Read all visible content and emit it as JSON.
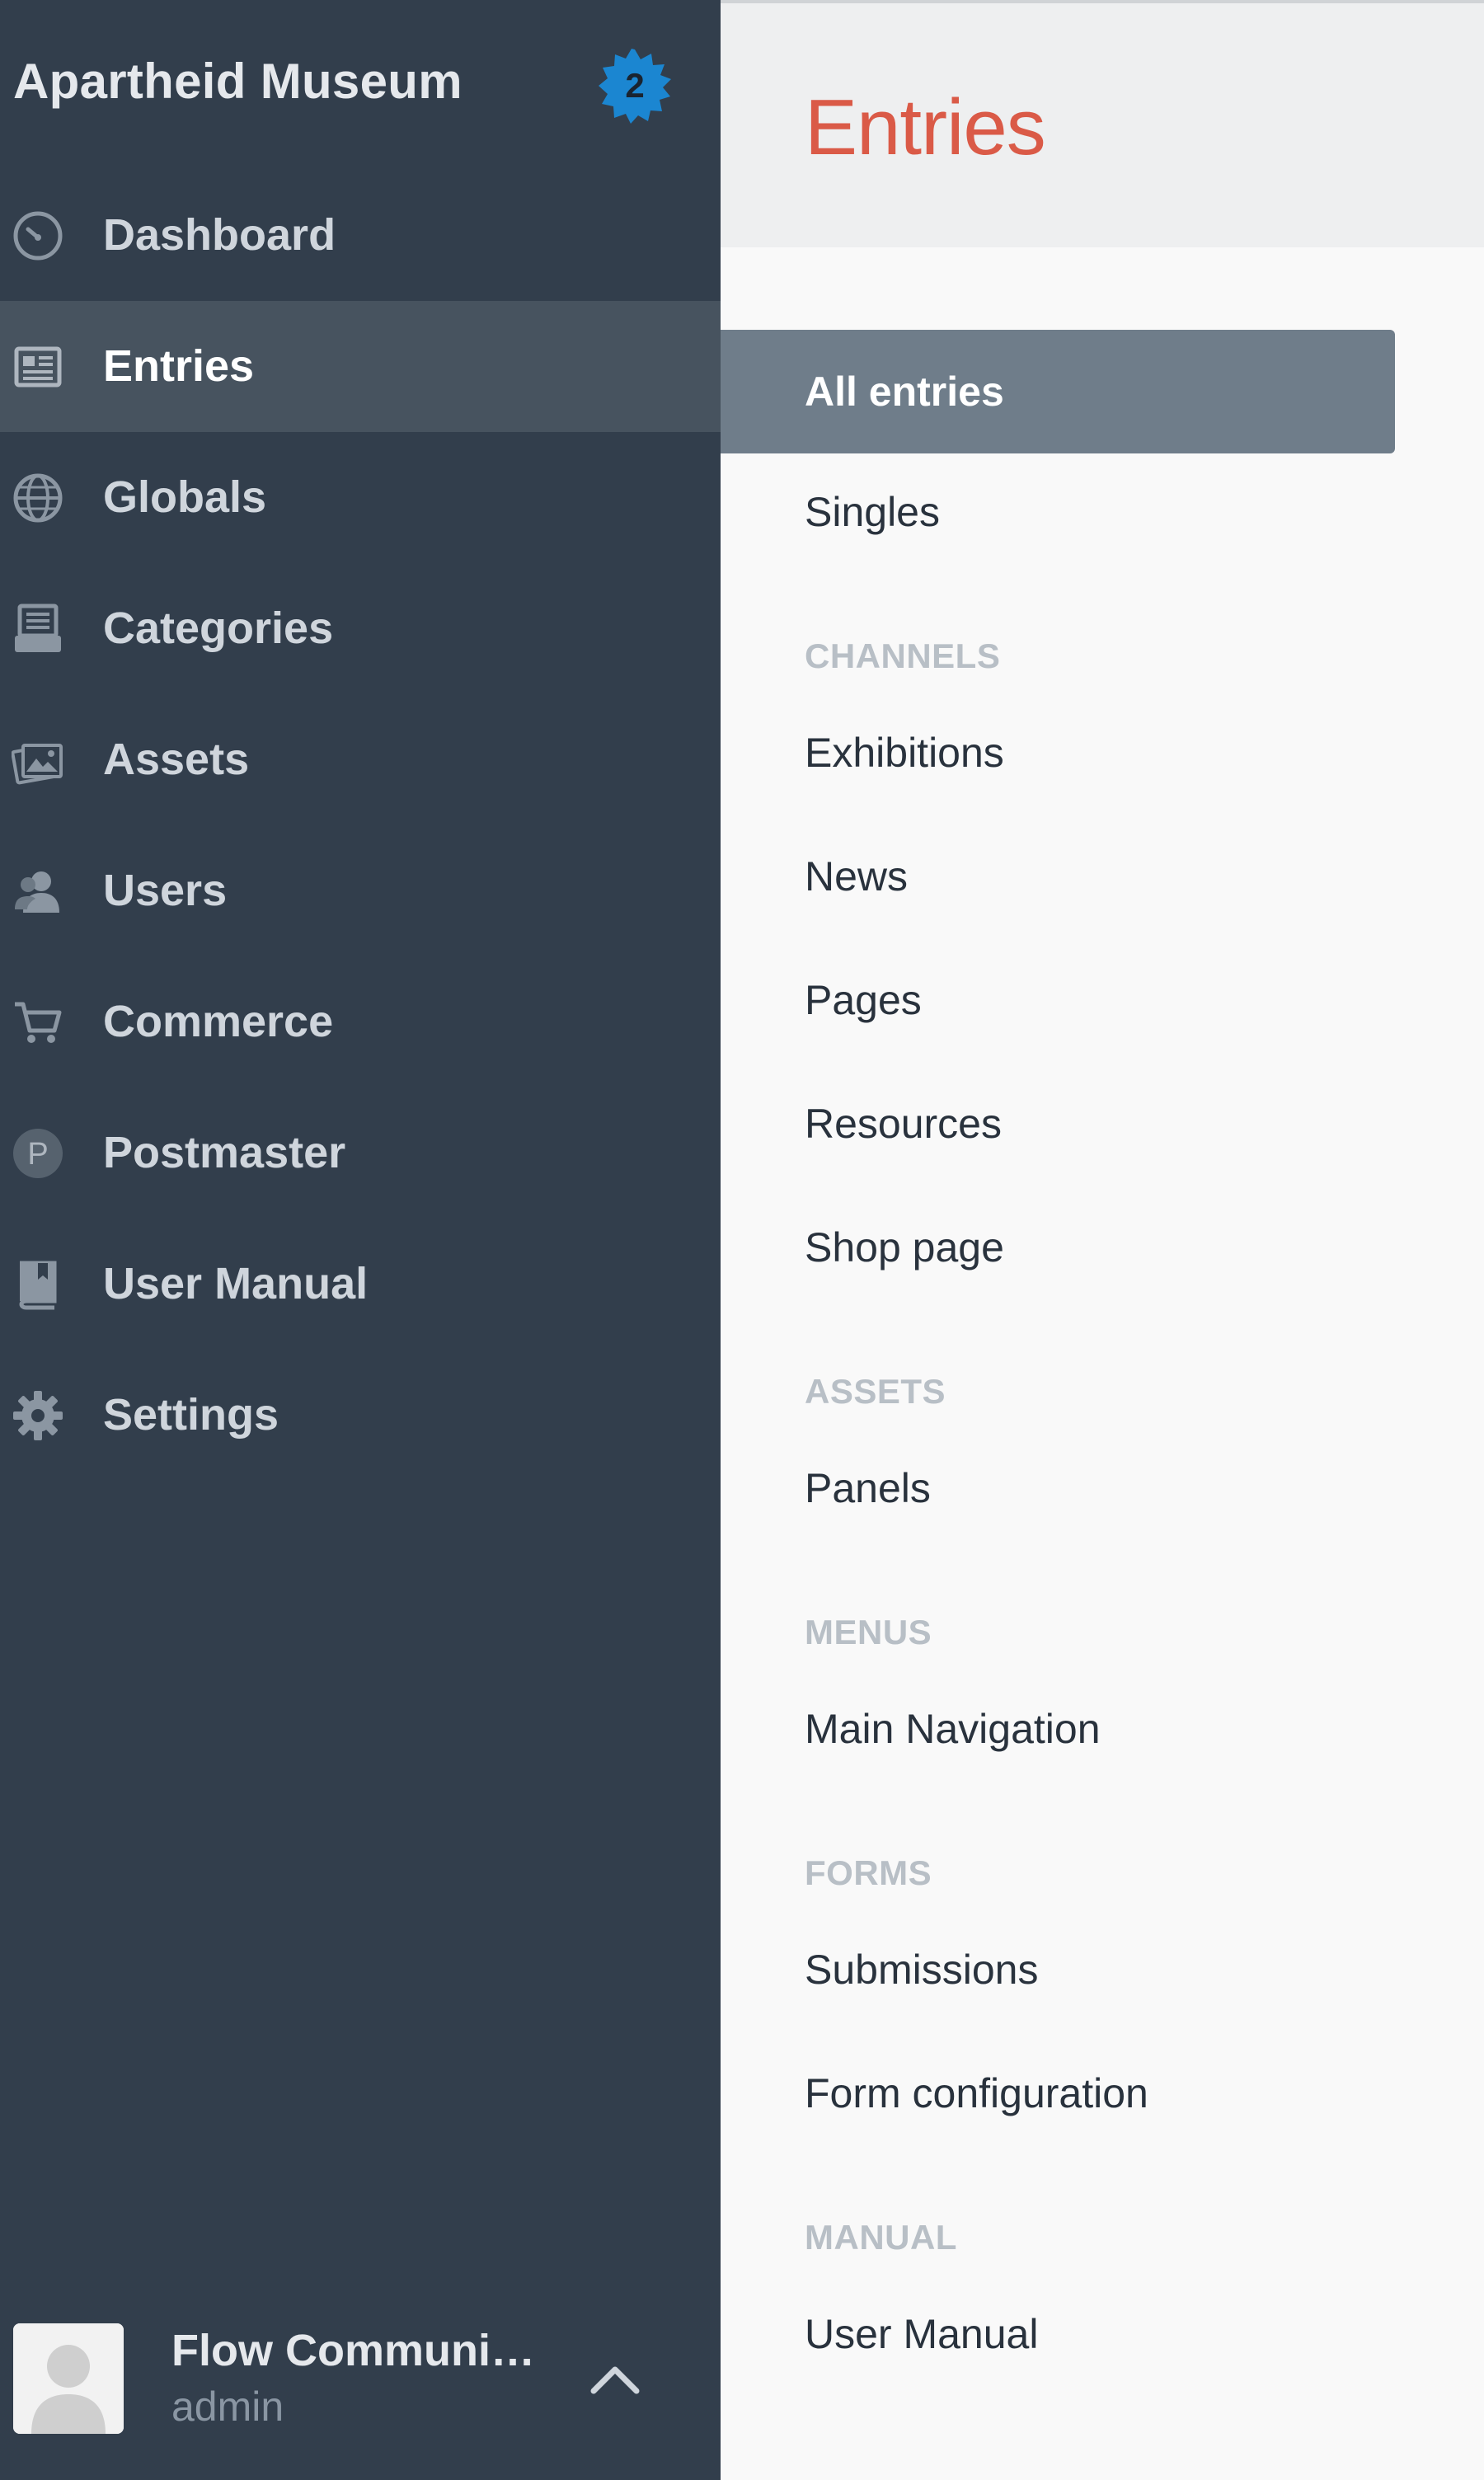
{
  "sidebar": {
    "site_name": "Apartheid Museum",
    "notification_count": "2",
    "items": [
      {
        "label": "Dashboard",
        "icon": "dashboard-icon"
      },
      {
        "label": "Entries",
        "icon": "newspaper-icon",
        "active": true
      },
      {
        "label": "Globals",
        "icon": "globe-icon"
      },
      {
        "label": "Categories",
        "icon": "categories-icon"
      },
      {
        "label": "Assets",
        "icon": "assets-icon"
      },
      {
        "label": "Users",
        "icon": "users-icon"
      },
      {
        "label": "Commerce",
        "icon": "cart-icon"
      },
      {
        "label": "Postmaster",
        "icon": "postmaster-icon",
        "icon_text": "P"
      },
      {
        "label": "User Manual",
        "icon": "book-icon"
      },
      {
        "label": "Settings",
        "icon": "gear-icon"
      }
    ],
    "user": {
      "name": "Flow Communi…",
      "role": "admin"
    }
  },
  "main": {
    "title": "Entries",
    "subnav": {
      "all_entries": "All entries",
      "singles": "Singles",
      "groups": [
        {
          "heading": "CHANNELS",
          "items": [
            "Exhibitions",
            "News",
            "Pages",
            "Resources",
            "Shop page"
          ]
        },
        {
          "heading": "ASSETS",
          "items": [
            "Panels"
          ]
        },
        {
          "heading": "MENUS",
          "items": [
            "Main Navigation"
          ]
        },
        {
          "heading": "FORMS",
          "items": [
            "Submissions",
            "Form configuration"
          ]
        },
        {
          "heading": "MANUAL",
          "items": [
            "User Manual"
          ]
        }
      ]
    }
  },
  "colors": {
    "sidebar_bg": "#323e4c",
    "sidebar_active": "#47535f",
    "title_accent": "#da5a47",
    "badge_blue": "#1b86d1",
    "selected_subnav": "#6f7d8a"
  }
}
